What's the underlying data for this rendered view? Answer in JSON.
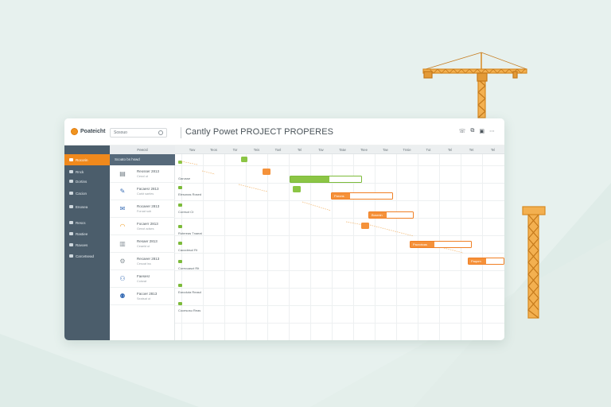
{
  "app": {
    "logo_text": "Poateicht",
    "search_placeholder": "Sosouo",
    "title": "Cantly Powet PROJECT PROPERES"
  },
  "topbar": {
    "icons": [
      {
        "name": "phone-icon",
        "glyph": "☏"
      },
      {
        "name": "copy-icon",
        "glyph": "⧉"
      },
      {
        "name": "save-icon",
        "glyph": "▣"
      },
      {
        "name": "menu-icon",
        "glyph": "⋯"
      }
    ]
  },
  "sidebar": {
    "items": [
      {
        "label": "Rocorin",
        "active": true
      },
      {
        "label": "Rnck"
      },
      {
        "label": "Dortins"
      },
      {
        "label": "Cacion"
      },
      {
        "label": "Enosea"
      },
      {
        "label": "Rescs"
      },
      {
        "label": "Rastiee"
      },
      {
        "label": "Ravoes"
      },
      {
        "label": "Carcetsead"
      }
    ]
  },
  "tasks": {
    "header": "Feecsl",
    "subheader": "Scoato bs hswd",
    "rows": [
      {
        "icon": "monitor-icon",
        "glyph": "▤",
        "title": "Reosser 2813",
        "sub": "Cesnl ut"
      },
      {
        "icon": "pen-icon",
        "glyph": "✎",
        "title": "Facaesr 2813",
        "sub": "Carkt saeles"
      },
      {
        "icon": "mail-icon",
        "glyph": "✉",
        "title": "Rocaeer 2813",
        "sub": "Foroat sub"
      },
      {
        "icon": "hardhat-icon",
        "glyph": "◠",
        "title": "Focaerr 2813",
        "sub": "Genot adses"
      },
      {
        "icon": "box-icon",
        "glyph": "▥",
        "title": "Resaer 2813",
        "sub": "Ceaeld ut"
      },
      {
        "icon": "gear-icon",
        "glyph": "⚙",
        "title": "Recaeer 2813",
        "sub": "Cesoat iss"
      },
      {
        "icon": "people-icon",
        "glyph": "⚇",
        "title": "Faesesr",
        "sub": "Coisrat"
      },
      {
        "icon": "group-icon",
        "glyph": "⚉",
        "title": "Facoer 2813",
        "sub": "Seatsat ut"
      }
    ]
  },
  "gantt": {
    "columns": [
      "Taw",
      "Teos",
      "Tor",
      "Teis",
      "Toel",
      "Tel",
      "Tav",
      "Tatw",
      "Tsee",
      "Tae",
      "Tnsie",
      "Tut",
      "Tel",
      "Tet",
      "Tel"
    ],
    "row_labels": [
      "Garusse",
      "Elesonas Rosed",
      "Coresot Ct",
      "Rotereas Tnaeat",
      "Cacodesol Rt",
      "Corecuasct Rlt",
      "Earoduta Reasd",
      "Cocesosu Reas"
    ],
    "bars": [
      {
        "label": "",
        "color": "green",
        "progress": 0.55
      },
      {
        "label": "Parons",
        "color": "orange",
        "progress": 0.3
      },
      {
        "label": "Bosrnin",
        "color": "orange",
        "progress": 0.4
      },
      {
        "label": "Pacrotoas",
        "color": "orange",
        "progress": 0.4
      },
      {
        "label": "Paqom",
        "color": "orange",
        "progress": 0.5
      }
    ]
  },
  "colors": {
    "accent": "#f0891c",
    "sidebar": "#4b5d6b",
    "green": "#8cc545",
    "background": "#e7f1ee"
  }
}
